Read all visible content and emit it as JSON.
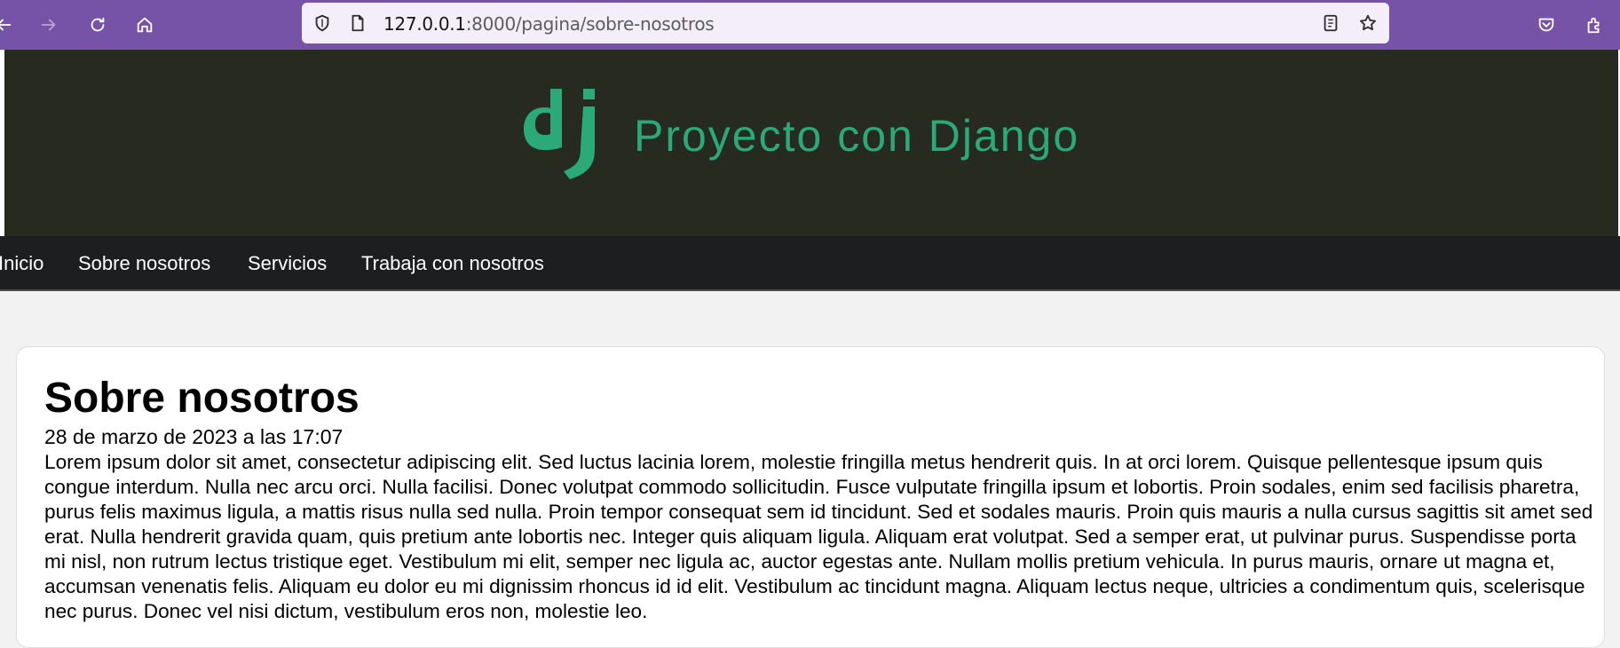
{
  "browser": {
    "url_host": "127.0.0.1",
    "url_path": ":8000/pagina/sobre-nosotros"
  },
  "site": {
    "title": "Proyecto con Django",
    "logo": "django-dj-logo"
  },
  "nav": {
    "items": [
      {
        "label": "Inicio"
      },
      {
        "label": "Sobre nosotros"
      },
      {
        "label": "Servicios"
      },
      {
        "label": "Trabaja con nosotros"
      }
    ]
  },
  "article": {
    "title": "Sobre nosotros",
    "date": "28 de marzo de 2023 a las 17:07",
    "body": "Lorem ipsum dolor sit amet, consectetur adipiscing elit. Sed luctus lacinia lorem, molestie fringilla metus hendrerit quis. In at orci lorem. Quisque pellentesque ipsum quis congue interdum. Nulla nec arcu orci. Nulla facilisi. Donec volutpat commodo sollicitudin. Fusce vulputate fringilla ipsum et lobortis. Proin sodales, enim sed facilisis pharetra, purus felis maximus ligula, a mattis risus nulla sed nulla. Proin tempor consequat sem id tincidunt. Sed et sodales mauris. Proin quis mauris a nulla cursus sagittis sit amet sed erat. Nulla hendrerit gravida quam, quis pretium ante lobortis nec. Integer quis aliquam ligula. Aliquam erat volutpat. Sed a semper erat, ut pulvinar purus. Suspendisse porta mi nisl, non rutrum lectus tristique eget. Vestibulum mi elit, semper nec ligula ac, auctor egestas ante. Nullam mollis pretium vehicula. In purus mauris, ornare ut magna et, accumsan venenatis felis. Aliquam eu dolor eu mi dignissim rhoncus id id elit. Vestibulum ac tincidunt magna. Aliquam lectus neque, ultricies a condimentum quis, scelerisque nec purus. Donec vel nisi dictum, vestibulum eros non, molestie leo."
  },
  "colors": {
    "browser_toolbar": "#7753a8",
    "header_bg": "#262a1f",
    "brand_green": "#2ba977",
    "nav_bg": "#1c1e1f",
    "page_bg": "#f2f2f2"
  }
}
